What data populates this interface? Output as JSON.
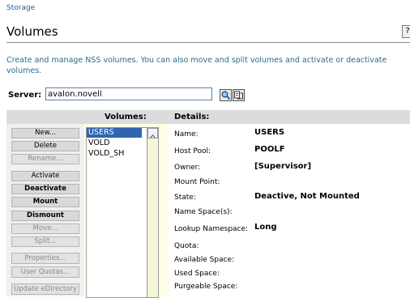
{
  "breadcrumb": "Storage",
  "page_title": "Volumes",
  "help_label": "?",
  "description": "Create and manage NSS volumes. You can also move and split volumes and activate or deactivate volumes.",
  "server": {
    "label": "Server:",
    "value": "avalon.novell"
  },
  "headers": {
    "volumes": "Volumes:",
    "details": "Details:"
  },
  "actions": [
    {
      "label": "New...",
      "enabled": true
    },
    {
      "label": "Delete",
      "enabled": true
    },
    {
      "label": "Rename...",
      "enabled": false
    },
    {
      "label": "Activate",
      "enabled": true
    },
    {
      "label": "Deactivate",
      "enabled": true
    },
    {
      "label": "Mount",
      "enabled": true
    },
    {
      "label": "Dismount",
      "enabled": true
    },
    {
      "label": "Move...",
      "enabled": false
    },
    {
      "label": "Split...",
      "enabled": false
    },
    {
      "label": "Properties...",
      "enabled": false
    },
    {
      "label": "User Quotas...",
      "enabled": false
    },
    {
      "label": "Update eDirectory",
      "enabled": false
    }
  ],
  "volumes": [
    {
      "name": "USERS",
      "selected": true
    },
    {
      "name": "VOLD",
      "selected": false
    },
    {
      "name": "VOLD_SH",
      "selected": false
    }
  ],
  "details": [
    {
      "label": "Name:",
      "value": "USERS"
    },
    {
      "label": "Host Pool:",
      "value": "POOLF"
    },
    {
      "label": "Owner:",
      "value": "[Supervisor]"
    },
    {
      "label": "Mount Point:",
      "value": ""
    },
    {
      "label": "State:",
      "value": "Deactive, Not Mounted"
    },
    {
      "label": "Name Space(s):",
      "value": ""
    },
    {
      "label": "Lookup Namespace:",
      "value": "Long"
    },
    {
      "label": "Quota:",
      "value": ""
    },
    {
      "label": "Available Space:",
      "value": ""
    },
    {
      "label": "Used Space:",
      "value": ""
    },
    {
      "label": "Purgeable Space:",
      "value": ""
    }
  ],
  "colors": {
    "selection": "#3064b0",
    "header_bar": "#dcdcdc",
    "list_panel": "#ffffe6",
    "description_text": "#2d6a8e"
  }
}
